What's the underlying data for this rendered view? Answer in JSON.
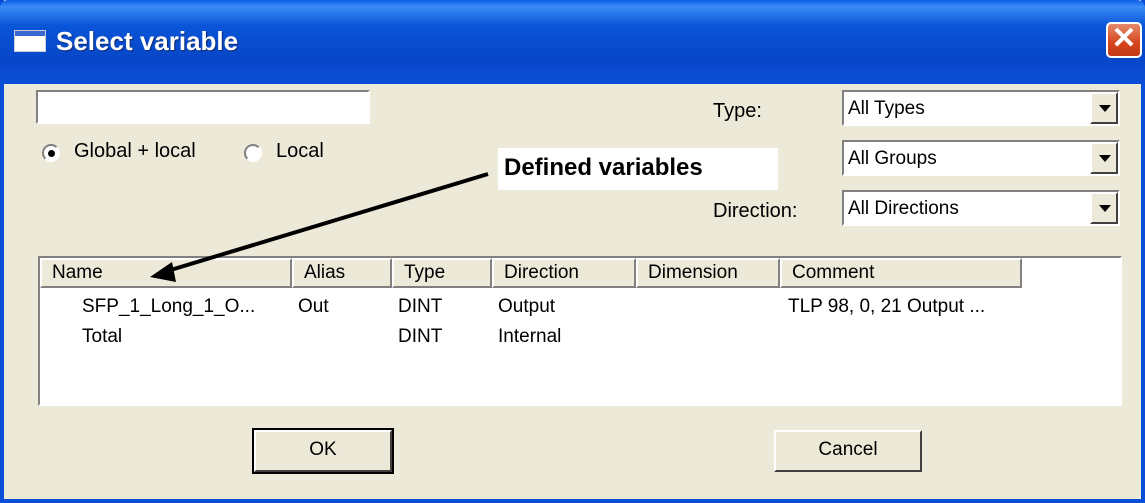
{
  "window": {
    "title": "Select variable",
    "close_glyph": "✕"
  },
  "filter": {
    "search_value": "",
    "scope_options": [
      {
        "label": "Global + local",
        "selected": true
      },
      {
        "label": "Local",
        "selected": false
      }
    ]
  },
  "filters": {
    "type_label": "Type:",
    "type_value": "All Types",
    "group_value": "All Groups",
    "direction_label": "Direction:",
    "direction_value": "All Directions"
  },
  "annotation": {
    "text": "Defined variables"
  },
  "table": {
    "columns": [
      "Name",
      "Alias",
      "Type",
      "Direction",
      "Dimension",
      "Comment"
    ],
    "rows": [
      [
        "SFP_1_Long_1_O...",
        "Out",
        "DINT",
        "Output",
        "",
        "TLP 98, 0, 21 Output ..."
      ],
      [
        "Total",
        "",
        "DINT",
        "Internal",
        "",
        ""
      ]
    ]
  },
  "buttons": {
    "ok": "OK",
    "cancel": "Cancel"
  },
  "icons": {
    "window_icon": "window-icon",
    "close": "close-icon",
    "dropdown": "chevron-down-icon"
  }
}
